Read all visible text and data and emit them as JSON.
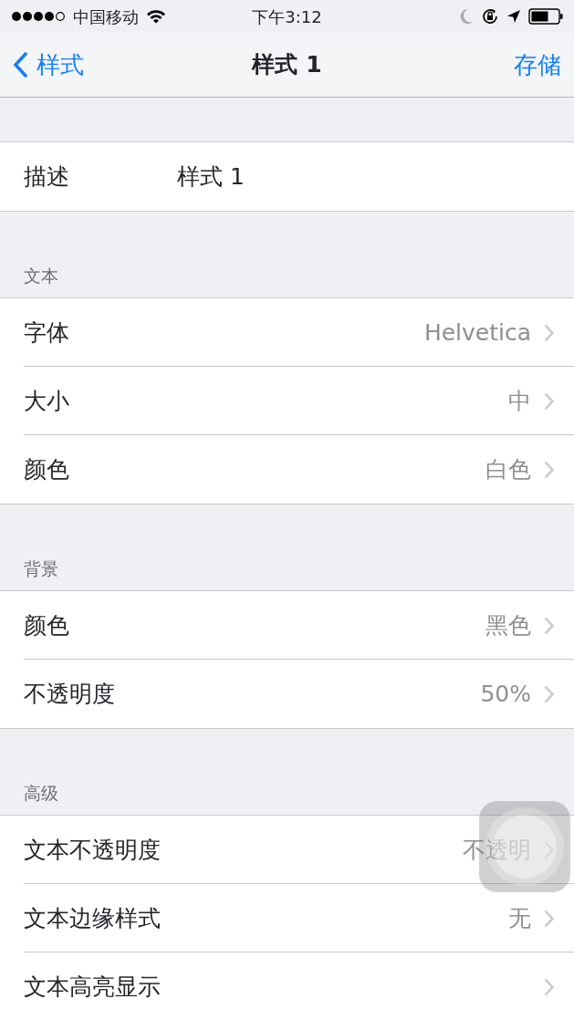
{
  "status_bar": {
    "carrier": "中国移动",
    "time": "下午3:12"
  },
  "nav": {
    "back": "样式",
    "title": "样式 1",
    "action": "存储"
  },
  "description": {
    "label": "描述",
    "value": "样式 1"
  },
  "sections": [
    {
      "header": "文本",
      "rows": [
        {
          "label": "字体",
          "value": "Helvetica"
        },
        {
          "label": "大小",
          "value": "中"
        },
        {
          "label": "颜色",
          "value": "白色"
        }
      ]
    },
    {
      "header": "背景",
      "rows": [
        {
          "label": "颜色",
          "value": "黑色"
        },
        {
          "label": "不透明度",
          "value": "50%"
        }
      ]
    },
    {
      "header": "高级",
      "rows": [
        {
          "label": "文本不透明度",
          "value": "不透明"
        },
        {
          "label": "文本边缘样式",
          "value": "无"
        },
        {
          "label": "文本高亮显示"
        }
      ]
    }
  ]
}
